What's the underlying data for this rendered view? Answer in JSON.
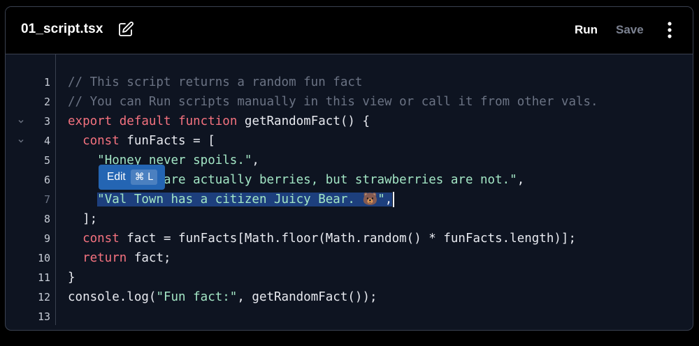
{
  "header": {
    "filename": "01_script.tsx",
    "run_label": "Run",
    "save_label": "Save"
  },
  "icons": {
    "edit": "pencil-square-icon",
    "more": "vertical-ellipsis-icon",
    "fold": "chevron-down-icon"
  },
  "tooltip": {
    "label": "Edit",
    "shortcut": "⌘ L"
  },
  "colors": {
    "background": "#0e1421",
    "header_bg": "#000000",
    "comment": "#6b7384",
    "keyword": "#f4727f",
    "string": "#a3e6c5",
    "selection": "#1d3f7d",
    "tooltip_bg": "#2465b3"
  },
  "editor": {
    "line_numbers": [
      "1",
      "2",
      "3",
      "4",
      "5",
      "6",
      "7",
      "8",
      "9",
      "10",
      "11",
      "12",
      "13"
    ],
    "lines": [
      [
        {
          "t": "// This script returns a random fun fact",
          "c": "cm"
        }
      ],
      [
        {
          "t": "// You can Run scripts manually in this view or call it from other vals.",
          "c": "cm"
        }
      ],
      [
        {
          "t": "export",
          "c": "kw"
        },
        {
          "t": " ",
          "c": "tx"
        },
        {
          "t": "default",
          "c": "kw"
        },
        {
          "t": " ",
          "c": "tx"
        },
        {
          "t": "function",
          "c": "kw"
        },
        {
          "t": " getRandomFact() {",
          "c": "fn"
        }
      ],
      [
        {
          "t": "  ",
          "c": "tx"
        },
        {
          "t": "const",
          "c": "kw"
        },
        {
          "t": " funFacts = [",
          "c": "tx"
        }
      ],
      [
        {
          "t": "    ",
          "c": "tx"
        },
        {
          "t": "\"Honey never spoils.\"",
          "c": "st"
        },
        {
          "t": ",",
          "c": "tx"
        }
      ],
      [
        {
          "t": "    ",
          "c": "tx"
        },
        {
          "t": "\"Bananas are actually berries, but strawberries are not.\"",
          "c": "st"
        },
        {
          "t": ",",
          "c": "tx"
        }
      ],
      [
        {
          "t": "    ",
          "c": "tx"
        },
        {
          "t": "\"Val Town has a citizen Juicy Bear. 🐻\"",
          "c": "st",
          "hl": true
        },
        {
          "t": ",",
          "c": "tx",
          "hl": true,
          "cursor": true
        }
      ],
      [
        {
          "t": "  ];",
          "c": "tx"
        }
      ],
      [
        {
          "t": "  ",
          "c": "tx"
        },
        {
          "t": "const",
          "c": "kw"
        },
        {
          "t": " fact = funFacts[Math.floor(Math.random() * funFacts.length)];",
          "c": "tx"
        }
      ],
      [
        {
          "t": "  ",
          "c": "tx"
        },
        {
          "t": "return",
          "c": "kw"
        },
        {
          "t": " fact;",
          "c": "tx"
        }
      ],
      [
        {
          "t": "}",
          "c": "tx"
        }
      ],
      [
        {
          "t": "console.log(",
          "c": "tx"
        },
        {
          "t": "\"Fun fact:\"",
          "c": "st"
        },
        {
          "t": ", getRandomFact());",
          "c": "tx"
        }
      ],
      []
    ],
    "foldable_lines": [
      3,
      4
    ]
  }
}
